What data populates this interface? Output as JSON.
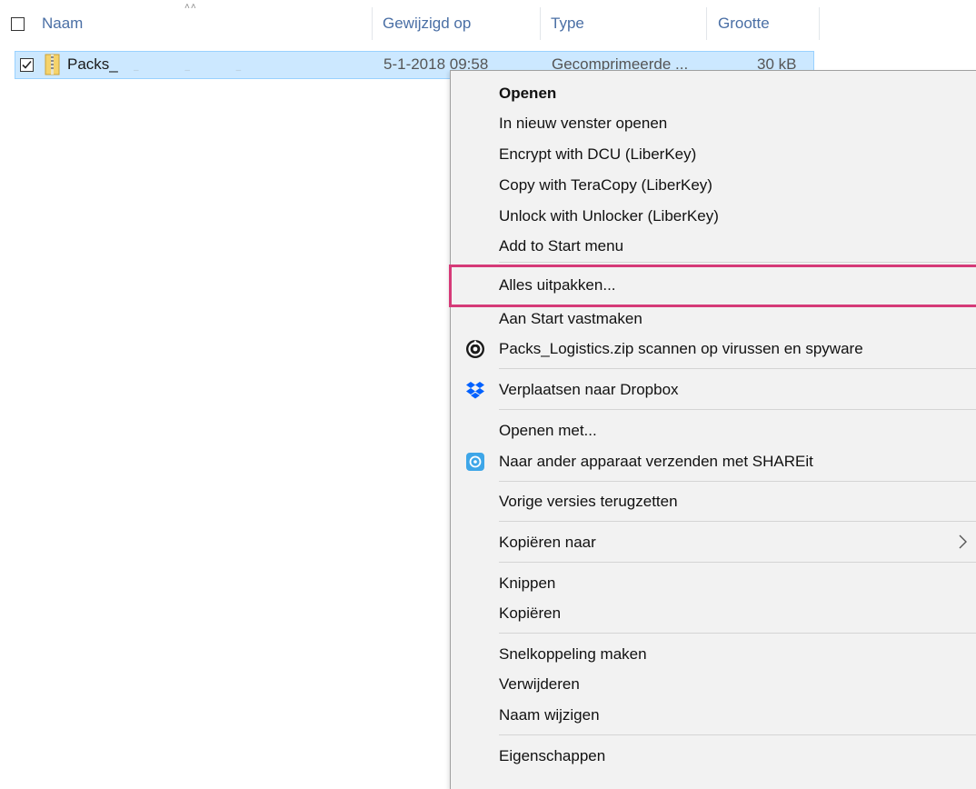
{
  "header": {
    "name": "Naam",
    "modified": "Gewijzigd op",
    "type": "Type",
    "size": "Grootte"
  },
  "file": {
    "name": "Packs_",
    "modified": "5-1-2018 09:58",
    "type": "Gecomprimeerde ...",
    "size": "30 kB",
    "checked": true
  },
  "menu": {
    "items": [
      {
        "label": "Openen"
      },
      {
        "label": "In nieuw venster openen"
      },
      {
        "label": "Encrypt with DCU (LiberKey)"
      },
      {
        "label": "Copy with TeraCopy (LiberKey)"
      },
      {
        "label": "Unlock with Unlocker (LiberKey)"
      },
      {
        "label": "Add to Start menu"
      },
      {
        "label": "Alles uitpakken..."
      },
      {
        "label": "Aan Start vastmaken"
      },
      {
        "label": "Packs_Logistics.zip scannen op virussen en spyware",
        "icon": "antivirus-icon"
      },
      {
        "label": "Verplaatsen naar Dropbox",
        "icon": "dropbox-icon"
      },
      {
        "label": "Openen met..."
      },
      {
        "label": "Naar ander apparaat verzenden met SHAREit",
        "icon": "shareit-icon"
      },
      {
        "label": "Vorige versies terugzetten"
      },
      {
        "label": "Kopiëren naar",
        "submenu": true
      },
      {
        "label": "Knippen"
      },
      {
        "label": "Kopiëren"
      },
      {
        "label": "Snelkoppeling maken"
      },
      {
        "label": "Verwijderen"
      },
      {
        "label": "Naam wijzigen"
      },
      {
        "label": "Eigenschappen"
      }
    ]
  },
  "colors": {
    "selection": "#cce8ff",
    "highlight_box": "#d63a78",
    "header_text": "#4a6fa5"
  }
}
